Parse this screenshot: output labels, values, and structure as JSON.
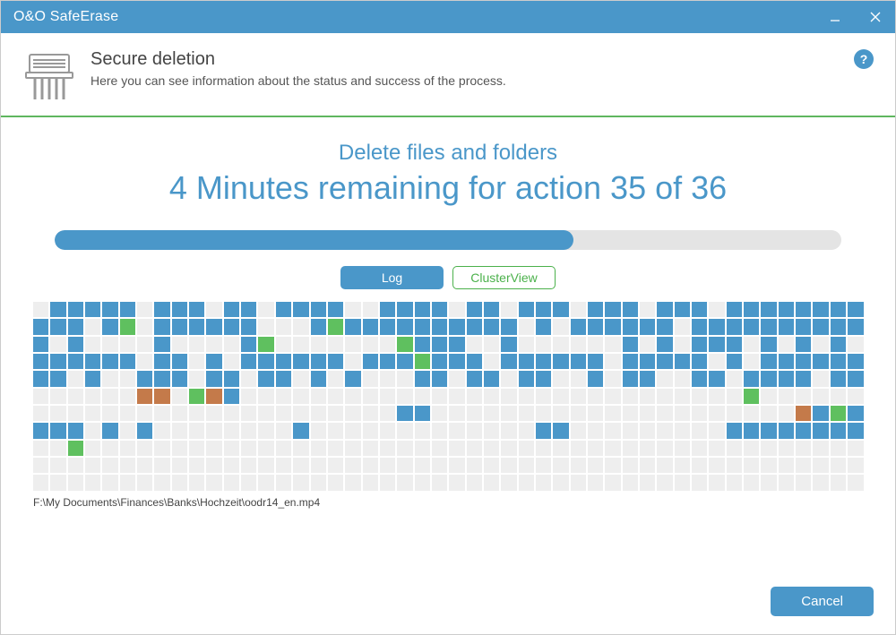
{
  "window": {
    "title": "O&O SafeErase"
  },
  "header": {
    "title": "Secure deletion",
    "subtitle": "Here you can see information about the status and success of the process.",
    "help_tooltip": "?"
  },
  "main": {
    "delete_title": "Delete files and folders",
    "remaining_text": "4 Minutes remaining for action 35 of 36",
    "progress_percent": 66,
    "tabs": {
      "log_label": "Log",
      "cluster_label": "ClusterView",
      "active": "cluster"
    },
    "file_path": "F:\\My Documents\\Finances\\Banks\\Hochzeit\\oodr14_en.mp4",
    "cluster_rows": [
      "-bbbbb-bbb-bb-bbbb--bbbb-bb-bbb-bbb-bbb-bbbbbbbb",
      "bbb-bg-bbbbbb---bgbbbbbbbbbb-b-bbbbbb-bbbbbbbbbb",
      "b-b----b----bg-------gbbb--b------b-b-bbb-b-b-b-",
      "bbbbbb-bb-b-bbbbbb-bbbgbbb-bbbbbb-bbbbb-b-bbbbbb",
      "bb-b--bbb-bb-bb-b-b---bb-bb-bb--b-bb--bb-bbbb-bb",
      "------oo-gob-----------------------------g------",
      "---------------------bb---------------------obgb",
      "bbb-b-b--------b-------------bb---------bbbbbbbb",
      "--g---------------------------------------------",
      "------------------------------------------------",
      "------------------------------------------------"
    ],
    "cluster_cols": 48
  },
  "footer": {
    "cancel_label": "Cancel"
  },
  "colors": {
    "accent": "#4a97c9",
    "green": "#5fc05f",
    "orange": "#c47a4a",
    "empty_cell": "#eeeeee",
    "divider_green": "#5fb65f"
  }
}
